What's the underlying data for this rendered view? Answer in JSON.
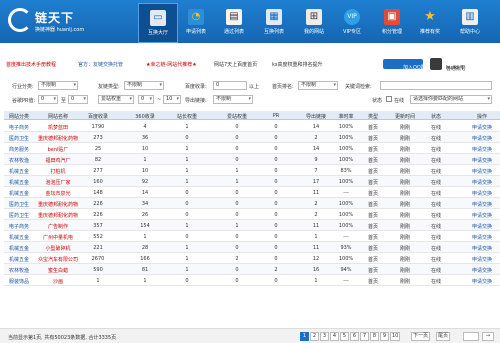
{
  "header": {
    "logo_title": "链天下",
    "logo_sub": "换链神器 huanlj.com",
    "nav": [
      {
        "label": "互换大厅",
        "icon": "monitor-icon",
        "active": true
      },
      {
        "label": "申请列表",
        "icon": "pie-chart-icon",
        "active": false
      },
      {
        "label": "通过列表",
        "icon": "clipboard-icon",
        "active": false
      },
      {
        "label": "互换列表",
        "icon": "list-monitor-icon",
        "active": false
      },
      {
        "label": "我的网站",
        "icon": "sitemap-icon",
        "active": false
      },
      {
        "label": "VIP专区",
        "icon": "vip-icon",
        "active": false
      },
      {
        "label": "积分管理",
        "icon": "gift-icon",
        "active": false
      },
      {
        "label": "推荐有奖",
        "icon": "star-icon",
        "active": false
      },
      {
        "label": "帮助中心",
        "icon": "book-icon",
        "active": false
      }
    ]
  },
  "notice": {
    "item1": "首度推出技术手册教程",
    "item2": "官方：友链交换托管",
    "item3": "★幸之链-网站代推荐★",
    "item4": "网站7天上百度首页",
    "item5": "ks高度权重和排名提升",
    "qq_button": "加入QQ群",
    "user_label": "普通账号",
    "user_name": "hurki fj"
  },
  "filters": {
    "industry_label": "行业分类:",
    "industry_value": "不限制",
    "site_type_label": "友链类型:",
    "site_type_value": "不限制",
    "baidu_label": "百度收录:",
    "baidu_value": "0",
    "above": "以上",
    "ranking_label": "首页排名:",
    "ranking_value": "不限制",
    "keyword_label": "关键词检索:",
    "keyword_value": "",
    "pr_label": "谷歌PR值:",
    "pr_value": "0",
    "pr_to": "至",
    "weight_value": "爱站权重",
    "weight_min": "0",
    "weight_to": "~",
    "weight_max": "10",
    "export_label": "导出链接:",
    "export_value": "不限制",
    "status_label": "状态",
    "online_label": "在线",
    "sort_value": "请选择你要匹配的网站"
  },
  "table": {
    "headers": [
      "网站分类",
      "网站名称",
      "百度收录",
      "360收录",
      "站长权重",
      "爱站权重",
      "PR",
      "导出链接",
      "准时率",
      "类型",
      "更新时间",
      "状态",
      "操作"
    ],
    "rows": [
      {
        "cat": "电子商务",
        "name": "凯梦蓝田",
        "baidu": "1790",
        "s360": "4",
        "zz": "1",
        "az": "0",
        "pr": "0",
        "out": "14",
        "rate": "100%",
        "type": "首页",
        "time": "刚刚",
        "status": "在线",
        "op": "申请交换"
      },
      {
        "cat": "医药卫生",
        "name": "重庆德邦耐化药物",
        "baidu": "273",
        "s360": "36",
        "zz": "0",
        "az": "0",
        "pr": "0",
        "out": "2",
        "rate": "100%",
        "type": "首页",
        "time": "刚刚",
        "status": "在线",
        "op": "申请交换"
      },
      {
        "cat": "商务服务",
        "name": "beni贴厂",
        "baidu": "25",
        "s360": "10",
        "zz": "1",
        "az": "0",
        "pr": "0",
        "out": "14",
        "rate": "100%",
        "type": "首页",
        "time": "刚刚",
        "status": "在线",
        "op": "申请交换"
      },
      {
        "cat": "农林牧渔",
        "name": "福田鸡汽厂",
        "baidu": "82",
        "s360": "1",
        "zz": "1",
        "az": "0",
        "pr": "0",
        "out": "9",
        "rate": "100%",
        "type": "首页",
        "time": "刚刚",
        "status": "在线",
        "op": "申请交换"
      },
      {
        "cat": "机械五金",
        "name": "打桩机",
        "baidu": "277",
        "s360": "10",
        "zz": "1",
        "az": "1",
        "pr": "0",
        "out": "7",
        "rate": "83%",
        "type": "首页",
        "time": "刚刚",
        "status": "在线",
        "op": "申请交换"
      },
      {
        "cat": "机械五金",
        "name": "泡泡压厂家",
        "baidu": "160",
        "s360": "92",
        "zz": "1",
        "az": "1",
        "pr": "0",
        "out": "17",
        "rate": "100%",
        "type": "首页",
        "time": "刚刚",
        "status": "在线",
        "op": "申请交换"
      },
      {
        "cat": "机械五金",
        "name": "金坛市泉光",
        "baidu": "148",
        "s360": "14",
        "zz": "0",
        "az": "0",
        "pr": "0",
        "out": "11",
        "rate": "---",
        "type": "首页",
        "time": "刚刚",
        "status": "在线",
        "op": "申请交换"
      },
      {
        "cat": "医药卫生",
        "name": "重庆德邦耐化药物",
        "baidu": "226",
        "s360": "34",
        "zz": "0",
        "az": "0",
        "pr": "0",
        "out": "2",
        "rate": "100%",
        "type": "首页",
        "time": "刚刚",
        "status": "在线",
        "op": "申请交换"
      },
      {
        "cat": "医药卫生",
        "name": "重庆德邦耐化药物",
        "baidu": "226",
        "s360": "26",
        "zz": "0",
        "az": "0",
        "pr": "0",
        "out": "2",
        "rate": "100%",
        "type": "首页",
        "time": "刚刚",
        "status": "在线",
        "op": "申请交换"
      },
      {
        "cat": "电子商务",
        "name": "广告制作",
        "baidu": "357",
        "s360": "154",
        "zz": "1",
        "az": "1",
        "pr": "0",
        "out": "11",
        "rate": "100%",
        "type": "首页",
        "time": "刚刚",
        "status": "在线",
        "op": "申请交换"
      },
      {
        "cat": "机械五金",
        "name": "广州中量机电",
        "baidu": "552",
        "s360": "1",
        "zz": "0",
        "az": "0",
        "pr": "0",
        "out": "1",
        "rate": "---",
        "type": "首页",
        "time": "刚刚",
        "status": "在线",
        "op": "申请交换"
      },
      {
        "cat": "机械五金",
        "name": "小型破碎机",
        "baidu": "221",
        "s360": "28",
        "zz": "1",
        "az": "0",
        "pr": "0",
        "out": "11",
        "rate": "93%",
        "type": "首页",
        "time": "刚刚",
        "status": "在线",
        "op": "申请交换"
      },
      {
        "cat": "机械五金",
        "name": "众宝汽车有限公司",
        "baidu": "2670",
        "s360": "166",
        "zz": "1",
        "az": "2",
        "pr": "0",
        "out": "12",
        "rate": "100%",
        "type": "首页",
        "time": "刚刚",
        "status": "在线",
        "op": "申请交换"
      },
      {
        "cat": "农林牧渔",
        "name": "蜜生白蜡",
        "baidu": "590",
        "s360": "81",
        "zz": "1",
        "az": "0",
        "pr": "2",
        "out": "16",
        "rate": "94%",
        "type": "首页",
        "time": "刚刚",
        "status": "在线",
        "op": "申请交换"
      },
      {
        "cat": "服装饰品",
        "name": "沙画",
        "baidu": "1",
        "s360": "1",
        "zz": "0",
        "az": "0",
        "pr": "0",
        "out": "1",
        "rate": "---",
        "type": "首页",
        "time": "刚刚",
        "status": "在线",
        "op": "申请交换"
      }
    ]
  },
  "footer": {
    "summary": "当前显示第1页, 共有50023条数据, 合计3335页",
    "pages": [
      "1",
      "2",
      "3",
      "4",
      "5",
      "6",
      "7",
      "8",
      "9",
      "10"
    ],
    "next": "下一页",
    "last": "尾页",
    "jump_value": ""
  }
}
